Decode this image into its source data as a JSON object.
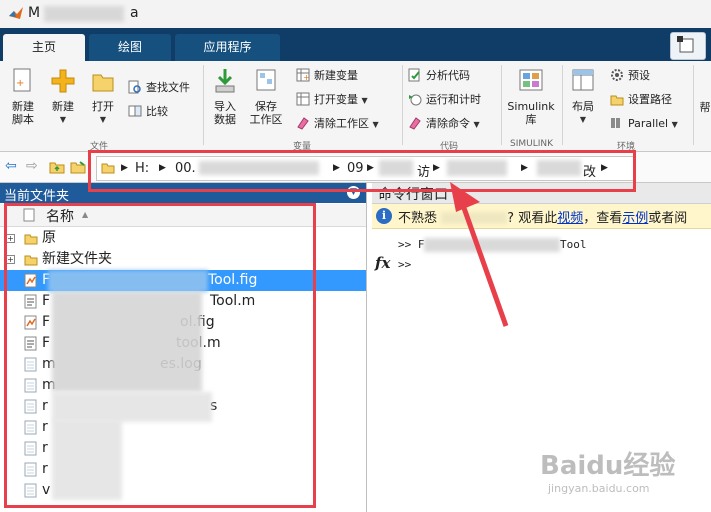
{
  "window": {
    "title_prefix": "M",
    "title_suffix": "a"
  },
  "tabs": [
    {
      "label": "主页",
      "active": true
    },
    {
      "label": "绘图",
      "active": false
    },
    {
      "label": "应用程序",
      "active": false
    }
  ],
  "ribbon": {
    "file": {
      "new_script": [
        "新建",
        "脚本"
      ],
      "new": "新建",
      "open": "打开",
      "find_files": "查找文件",
      "compare": "比较",
      "group_label": "文件"
    },
    "variable": {
      "import_data": [
        "导入",
        "数据"
      ],
      "save_workspace": [
        "保存",
        "工作区"
      ],
      "new_variable": "新建变量",
      "open_variable": "打开变量",
      "clear_workspace": "清除工作区",
      "group_label": "变量"
    },
    "code": {
      "analyze_code": "分析代码",
      "run_and_time": "运行和计时",
      "clear_commands": "清除命令",
      "group_label": "代码"
    },
    "simulink": {
      "label": [
        "Simulink",
        "库"
      ],
      "group_label": "SIMULINK"
    },
    "environment": {
      "layout": "布局",
      "preferences": "预设",
      "set_path": "设置路径",
      "parallel": "Parallel",
      "group_label": "环境"
    },
    "help_partial": "帮"
  },
  "address": {
    "drive": "H:",
    "seg1": "00.",
    "seg2": "09",
    "seg3_tail": "访",
    "seg5_tail": "改"
  },
  "current_folder": {
    "title": "当前文件夹",
    "column_name": "名称",
    "sort_glyph": "▲",
    "items": [
      {
        "prefix": "",
        "suffix": "原",
        "type": "folder",
        "expandable": true,
        "selected": false
      },
      {
        "prefix": "",
        "suffix": "新建文件夹",
        "type": "folder",
        "expandable": true,
        "selected": false
      },
      {
        "prefix": "F",
        "suffix": "Tool.fig",
        "type": "fig",
        "selected": true
      },
      {
        "prefix": "F",
        "suffix": "Tool.m",
        "type": "m",
        "selected": false
      },
      {
        "prefix": "F",
        "suffix": "ol.fig",
        "type": "fig",
        "selected": false
      },
      {
        "prefix": "F",
        "suffix": "tool.m",
        "type": "m",
        "selected": false
      },
      {
        "prefix": "m",
        "suffix": "es.log",
        "type": "log",
        "selected": false
      },
      {
        "prefix": "m",
        "suffix": "",
        "type": "file",
        "selected": false
      },
      {
        "prefix": "r",
        "suffix": "s",
        "type": "file",
        "selected": false
      },
      {
        "prefix": "r",
        "suffix": "",
        "type": "file",
        "selected": false
      },
      {
        "prefix": "r",
        "suffix": "",
        "type": "file",
        "selected": false
      },
      {
        "prefix": "r",
        "suffix": "",
        "type": "file",
        "selected": false
      },
      {
        "prefix": "v",
        "suffix": "",
        "type": "file",
        "selected": false
      }
    ]
  },
  "command_window": {
    "title": "命令行窗口",
    "info": {
      "prefix": "不熟悉",
      "q_tail": "? 观看此",
      "link_video": "视频",
      "mid": "，查看",
      "link_examples": "示例",
      "tail": "或者阅"
    },
    "prompt_history": ">> F",
    "history_tail": "Tool",
    "prompt_current": ">>",
    "fx": "fx"
  },
  "watermark": {
    "brand": "Baidu经验",
    "url": "jingyan.baidu.com"
  },
  "colors": {
    "accent_tab_bar": "#0f3d68",
    "panel_header": "#1f5a9b",
    "selection": "#3399ff",
    "annotation": "#e8404a"
  }
}
